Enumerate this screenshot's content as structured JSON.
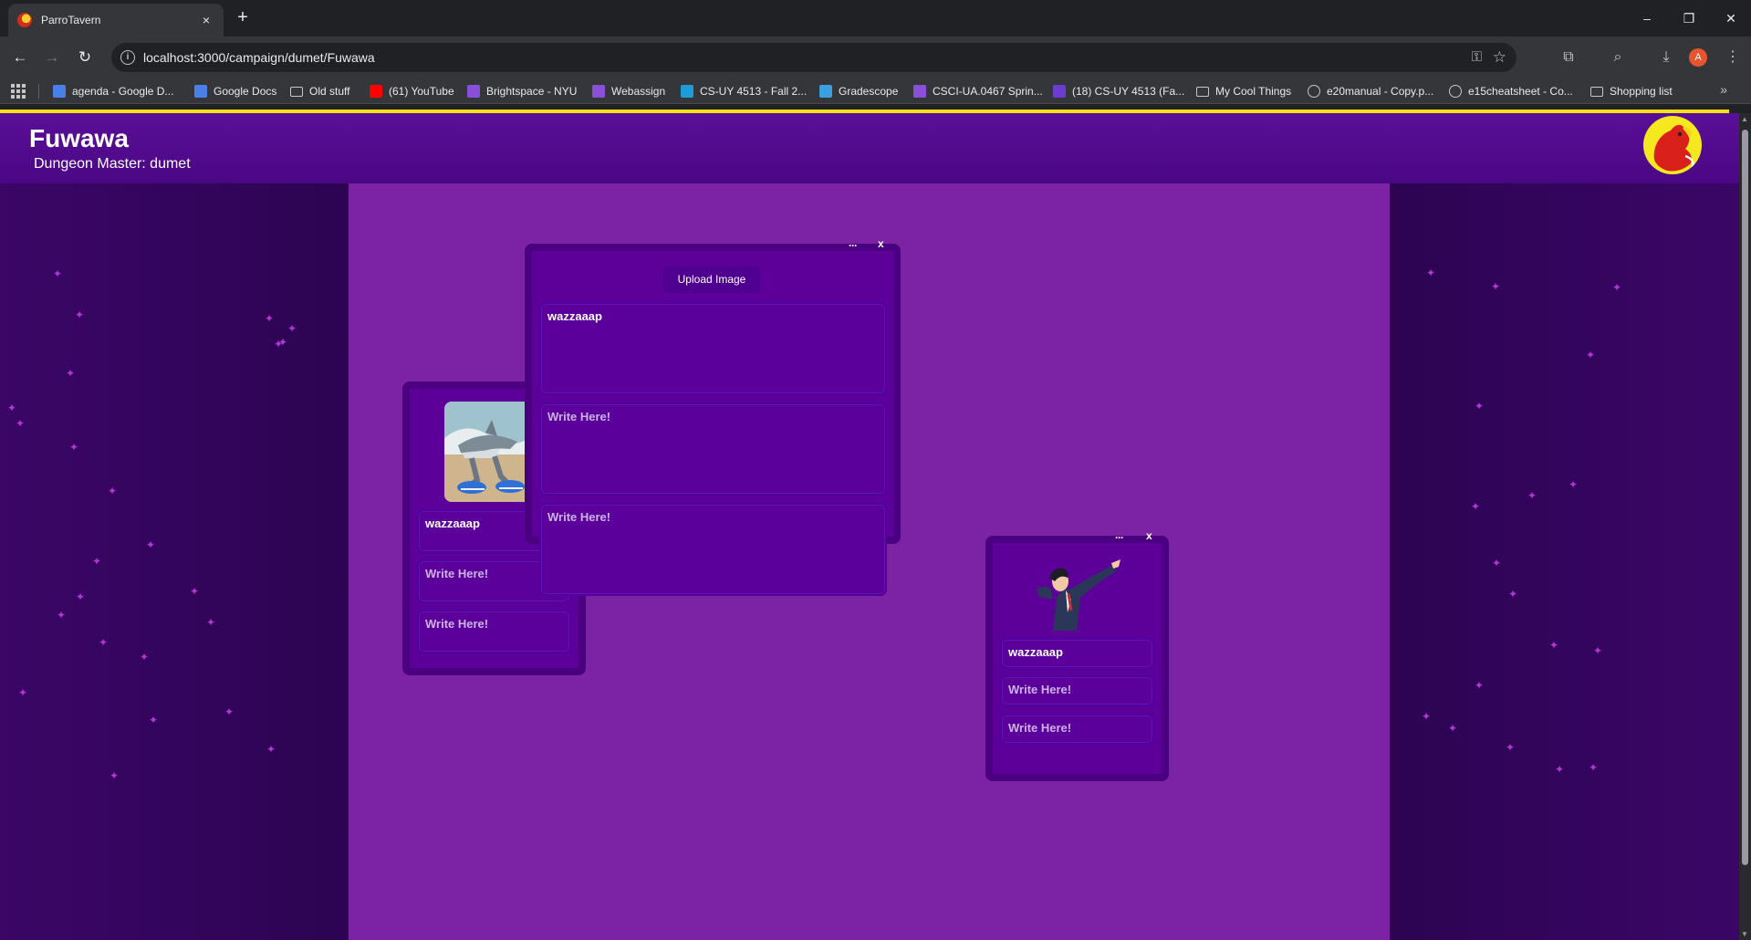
{
  "browser": {
    "tab_title": "ParroTavern",
    "tab_close": "×",
    "new_tab": "+",
    "url": "localhost:3000/campaign/dumet/Fuwawa",
    "profile_initial": "A",
    "window_controls": {
      "minimize": "–",
      "restore": "❐",
      "close": "✕"
    }
  },
  "bookmarks": [
    {
      "label": "agenda - Google D...",
      "icon": "google-docs-icon",
      "color": "#4a7ee8"
    },
    {
      "label": "Google Docs",
      "icon": "google-docs-icon",
      "color": "#4a7ee8"
    },
    {
      "label": "Old stuff",
      "icon": "folder-icon",
      "color": "#c4c7c5"
    },
    {
      "label": "(61) YouTube",
      "icon": "youtube-icon",
      "color": "#ff0000"
    },
    {
      "label": "Brightspace - NYU",
      "icon": "brightspace-icon",
      "color": "#8a4fd8"
    },
    {
      "label": "Webassign",
      "icon": "brightspace-icon",
      "color": "#8a4fd8"
    },
    {
      "label": "CS-UY 4513 - Fall 2...",
      "icon": "webex-icon",
      "color": "#1f9bd6"
    },
    {
      "label": "Gradescope",
      "icon": "gradescope-icon",
      "color": "#3aa0e0"
    },
    {
      "label": "CSCI-UA.0467 Sprin...",
      "icon": "brightspace-icon",
      "color": "#8a4fd8"
    },
    {
      "label": "(18) CS-UY 4513 (Fa...",
      "icon": "ed-icon",
      "color": "#6c3cd0"
    },
    {
      "label": "My Cool Things",
      "icon": "folder-icon",
      "color": "#c4c7c5"
    },
    {
      "label": "e20manual - Copy.p...",
      "icon": "globe-icon",
      "color": "#c4c7c5"
    },
    {
      "label": "e15cheatsheet - Co...",
      "icon": "globe-icon",
      "color": "#c4c7c5"
    },
    {
      "label": "Shopping list",
      "icon": "folder-icon",
      "color": "#c4c7c5"
    }
  ],
  "bookmarks_more": "»",
  "campaign": {
    "title": "Fuwawa",
    "dungeon_master": "Dungeon Master: dumet"
  },
  "cards": {
    "card_left": {
      "image": "shark-with-sneakers-image",
      "fields": [
        "wazzaaap",
        "Write Here!",
        "Write Here!"
      ]
    },
    "card_center": {
      "menu": "···",
      "close": "x",
      "upload_label": "Upload Image",
      "fields": [
        "wazzaaap",
        "Write Here!",
        "Write Here!"
      ]
    },
    "card_right": {
      "menu": "···",
      "close": "x",
      "image": "pointing-lawyer-image",
      "fields": [
        "wazzaaap",
        "Write Here!",
        "Write Here!"
      ]
    }
  },
  "colors": {
    "header": "#4a0784",
    "board": "#7b23a3",
    "card": "#5d0099",
    "accent_bar": "#f3e21a"
  }
}
